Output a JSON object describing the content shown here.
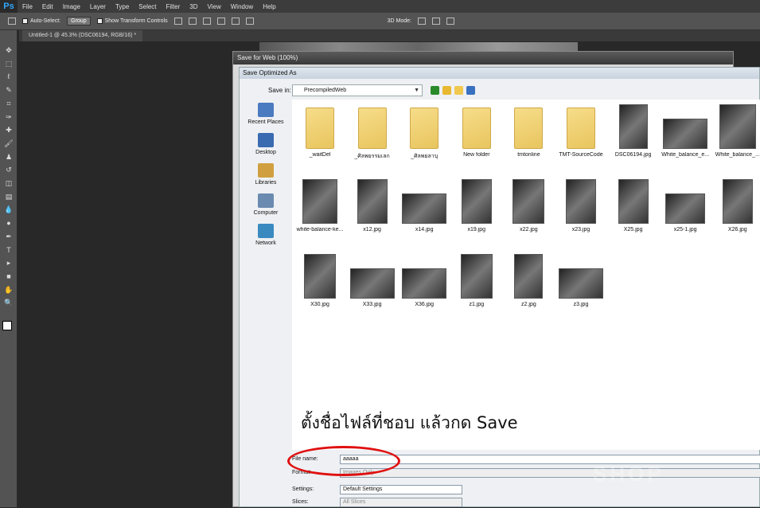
{
  "menubar": {
    "logo": "Ps",
    "items": [
      "File",
      "Edit",
      "Image",
      "Layer",
      "Type",
      "Select",
      "Filter",
      "3D",
      "View",
      "Window",
      "Help"
    ]
  },
  "options": {
    "auto_select": "Auto-Select:",
    "group": "Group",
    "show_transform": "Show Transform Controls",
    "mode_3d": "3D Mode:"
  },
  "document": {
    "tab": "Untitled-1 @ 45.3% (DSC06194, RGB/16) *"
  },
  "save_for_web": {
    "title": "Save for Web (100%)"
  },
  "dialog": {
    "title": "Save Optimized As",
    "save_in_label": "Save in:",
    "save_in_value": "PrecompiledWeb",
    "places": [
      "Recent Places",
      "Desktop",
      "Libraries",
      "Computer",
      "Network"
    ],
    "files": [
      {
        "name": "_waitDel",
        "kind": "folder"
      },
      {
        "name": "_ศิลพยรรมเลก",
        "kind": "folder"
      },
      {
        "name": "_ศิลพยลาบุ",
        "kind": "folder"
      },
      {
        "name": "New folder",
        "kind": "folder"
      },
      {
        "name": "tmtonline",
        "kind": "folder"
      },
      {
        "name": "TMT-SourceCode",
        "kind": "folder"
      },
      {
        "name": "DSC06194.jpg",
        "kind": "photo"
      },
      {
        "name": "White_balance_e...",
        "kind": "photo"
      },
      {
        "name": "White_balance_...",
        "kind": "photo"
      },
      {
        "name": "white-balance-ke...",
        "kind": "photo"
      },
      {
        "name": "x12.jpg",
        "kind": "photo"
      },
      {
        "name": "x14.jpg",
        "kind": "photo"
      },
      {
        "name": "x19.jpg",
        "kind": "photo"
      },
      {
        "name": "x22.jpg",
        "kind": "photo"
      },
      {
        "name": "x23.jpg",
        "kind": "photo"
      },
      {
        "name": "X25.jpg",
        "kind": "photo"
      },
      {
        "name": "x25-1.jpg",
        "kind": "photo"
      },
      {
        "name": "X26.jpg",
        "kind": "photo"
      },
      {
        "name": "X30.jpg",
        "kind": "photo"
      },
      {
        "name": "X33.jpg",
        "kind": "photo"
      },
      {
        "name": "X36.jpg",
        "kind": "photo"
      },
      {
        "name": "z1.jpg",
        "kind": "photo"
      },
      {
        "name": "z2.jpg",
        "kind": "photo"
      },
      {
        "name": "z3.jpg",
        "kind": "photo"
      }
    ],
    "file_name_label": "File name:",
    "file_name_value": "aaaaa",
    "format_label": "Format:",
    "format_value": "Images Only",
    "settings_label": "Settings:",
    "settings_value": "Default Settings",
    "slices_label": "Slices:",
    "slices_value": "All Slices"
  },
  "overlay": {
    "instruction": "ตั้งชื่อไฟล์ที่ชอบ แล้วกด Save"
  },
  "watermark": "SHOP",
  "colors": {
    "highlight": "#e01010",
    "ps_blue": "#31a8ff"
  }
}
